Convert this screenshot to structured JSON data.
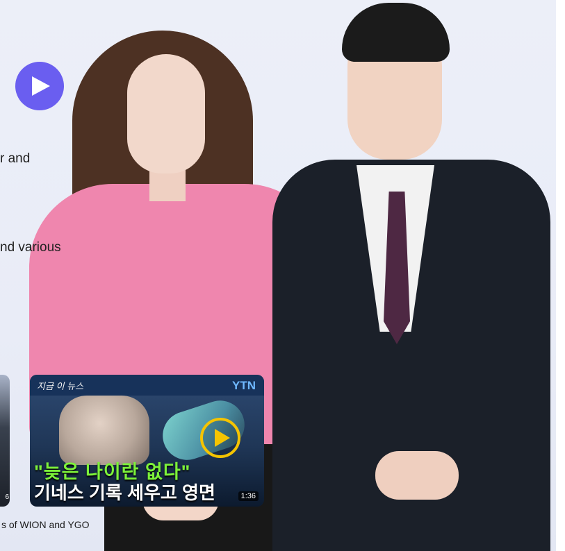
{
  "hero": {
    "play_button_label": "Play"
  },
  "text_fragments": {
    "line1": "r and",
    "line2": "nd various"
  },
  "videos": [
    {
      "title": "",
      "duration": "6"
    },
    {
      "channel_tag": "지금 이 뉴스",
      "brand": "YTN",
      "headline_line1": "\"늦은 나이란 없다\"",
      "headline_line2": "기네스 기록 세우고 영면",
      "duration": "1:36"
    }
  ],
  "caption": "s of WION and YGO",
  "colors": {
    "play_button": "#6a5ef0",
    "background": "#eceff8",
    "headline_green": "#7df23a",
    "play_ring": "#f5c400"
  }
}
